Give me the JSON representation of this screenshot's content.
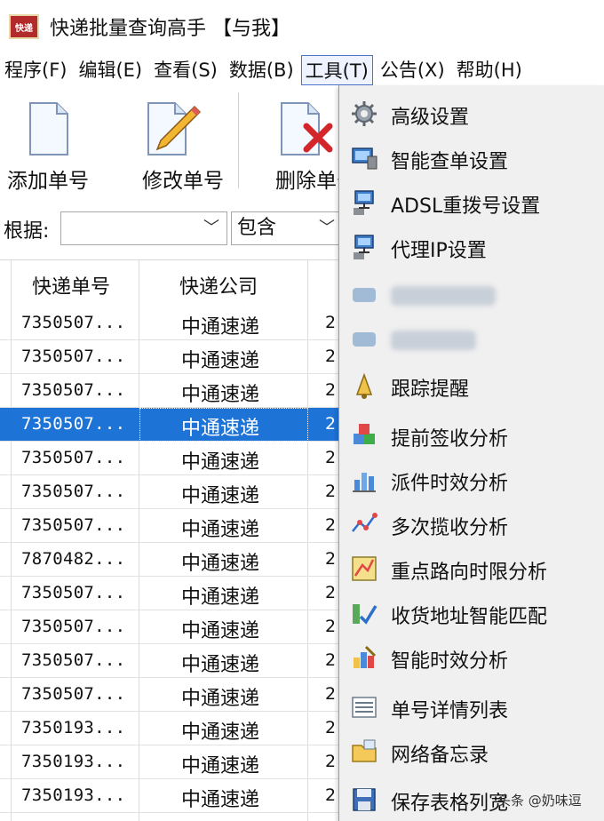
{
  "window": {
    "title": "快递批量查询高手 【与我】",
    "icon_text": "快递"
  },
  "menubar": [
    {
      "label": "程序(F)"
    },
    {
      "label": "编辑(E)"
    },
    {
      "label": "查看(S)"
    },
    {
      "label": "数据(B)"
    },
    {
      "label": "工具(T)"
    },
    {
      "label": "公告(X)"
    },
    {
      "label": "帮助(H)"
    }
  ],
  "toolbar": {
    "add_label": "添加单号",
    "edit_label": "修改单号",
    "delete_label": "删除单号"
  },
  "filter": {
    "label": "根据:",
    "field_value": "",
    "match_value": "包含"
  },
  "grid": {
    "headers": [
      "快递单号",
      "快递公司"
    ],
    "rows": [
      {
        "no": "7350507...",
        "company": "中通速递",
        "extra": "2"
      },
      {
        "no": "7350507...",
        "company": "中通速递",
        "extra": "2"
      },
      {
        "no": "7350507...",
        "company": "中通速递",
        "extra": "2"
      },
      {
        "no": "7350507...",
        "company": "中通速递",
        "extra": "2"
      },
      {
        "no": "7350507...",
        "company": "中通速递",
        "extra": "2"
      },
      {
        "no": "7350507...",
        "company": "中通速递",
        "extra": "2"
      },
      {
        "no": "7350507...",
        "company": "中通速递",
        "extra": "2"
      },
      {
        "no": "7870482...",
        "company": "中通速递",
        "extra": "2"
      },
      {
        "no": "7350507...",
        "company": "中通速递",
        "extra": "2"
      },
      {
        "no": "7350507...",
        "company": "中通速递",
        "extra": "2"
      },
      {
        "no": "7350507...",
        "company": "中通速递",
        "extra": "2"
      },
      {
        "no": "7350507...",
        "company": "中通速递",
        "extra": "2"
      },
      {
        "no": "7350193...",
        "company": "中通速递",
        "extra": "2"
      },
      {
        "no": "7350193...",
        "company": "中通速递",
        "extra": "2"
      },
      {
        "no": "7350193...",
        "company": "中通速递",
        "extra": "2"
      }
    ],
    "selected_row_number": 4,
    "selection_color": "#1e73d6"
  },
  "tools_menu": {
    "items": [
      {
        "label": "高级设置",
        "icon": "gear-icon"
      },
      {
        "label": "智能查单设置",
        "icon": "monitor-icon"
      },
      {
        "label": "ADSL重拨号设置",
        "icon": "network-icon"
      },
      {
        "label": "代理IP设置",
        "icon": "network-icon"
      },
      {
        "label": "",
        "icon": "blurred-icon"
      },
      {
        "label": "",
        "icon": "blurred-icon"
      },
      {
        "label": "跟踪提醒",
        "icon": "bell-icon"
      },
      {
        "label": "提前签收分析",
        "icon": "cubes-icon"
      },
      {
        "label": "派件时效分析",
        "icon": "bar-chart-icon"
      },
      {
        "label": "多次揽收分析",
        "icon": "line-chart-icon"
      },
      {
        "label": "重点路向时限分析",
        "icon": "map-icon"
      },
      {
        "label": "收货地址智能匹配",
        "icon": "match-icon"
      },
      {
        "label": "智能时效分析",
        "icon": "pencil-chart-icon"
      },
      {
        "label": "单号详情列表",
        "icon": "list-icon"
      },
      {
        "label": "网络备忘录",
        "icon": "folder-icon"
      },
      {
        "label": "保存表格列宽",
        "icon": "save-icon"
      }
    ]
  },
  "watermark": "头条 @奶味逗"
}
